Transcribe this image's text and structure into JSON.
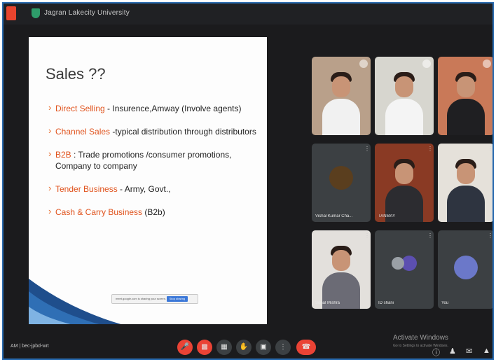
{
  "window": {
    "title": "Jagran Lakecity University"
  },
  "slide": {
    "title": "Sales ??",
    "bullets": [
      {
        "key": "Direct Selling",
        "rest": " - Insurence,Amway (Involve agents)"
      },
      {
        "key": "Channel Sales",
        "rest": " -typical distribution through distributors"
      },
      {
        "key": "B2B",
        "rest": " : Trade promotions /consumer promotions, Company to company"
      },
      {
        "key": "Tender Business",
        "rest": " - Army, Govt.,"
      },
      {
        "key": "Cash & Carry Business",
        "rest": " (B2b)"
      }
    ],
    "share_bar": {
      "text": "meet.google.com is sharing your screen.",
      "button": "Stop sharing"
    }
  },
  "participants": [
    {
      "name": "",
      "kind": "video"
    },
    {
      "name": "",
      "kind": "video"
    },
    {
      "name": "",
      "kind": "video"
    },
    {
      "name": "Vishal Kumar Cha...",
      "kind": "avatar"
    },
    {
      "name": "TANMAY",
      "kind": "video"
    },
    {
      "name": "",
      "kind": "video"
    },
    {
      "name": "Sonal Mishra",
      "kind": "video"
    },
    {
      "name": "ID shani",
      "kind": "avatar"
    },
    {
      "name": "You",
      "kind": "avatar"
    }
  ],
  "bottom": {
    "meeting_label": "AM | bec-jpbd-wrt",
    "controls": [
      "mic-off",
      "camera-off",
      "captions",
      "raise-hand",
      "present",
      "more",
      "end-call"
    ]
  },
  "watermark": {
    "title": "Activate Windows",
    "subtitle": "Go to Settings to activate Windows."
  },
  "colors": {
    "accent_orange": "#e0531d",
    "end_call": "#ea4335",
    "tile_bg": "#3c4043"
  }
}
